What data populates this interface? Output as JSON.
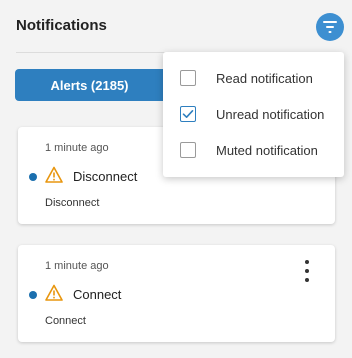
{
  "header": {
    "title": "Notifications",
    "filter_icon": "filter-icon"
  },
  "tabs": {
    "alerts_label": "Alerts (2185)"
  },
  "filter_menu": {
    "items": [
      {
        "label": "Read notification",
        "checked": false
      },
      {
        "label": "Unread notification",
        "checked": true
      },
      {
        "label": "Muted notification",
        "checked": false
      }
    ]
  },
  "notifications": [
    {
      "time": "1 minute ago",
      "title": "Disconnect",
      "description": "Disconnect",
      "status_icon": "warning-icon",
      "unread": true
    },
    {
      "time": "1 minute ago",
      "title": "Connect",
      "description": "Connect",
      "status_icon": "warning-icon",
      "unread": true
    }
  ],
  "colors": {
    "accent": "#2e7fbf",
    "unread_dot": "#1b6fae",
    "warning": "#e8960e"
  }
}
